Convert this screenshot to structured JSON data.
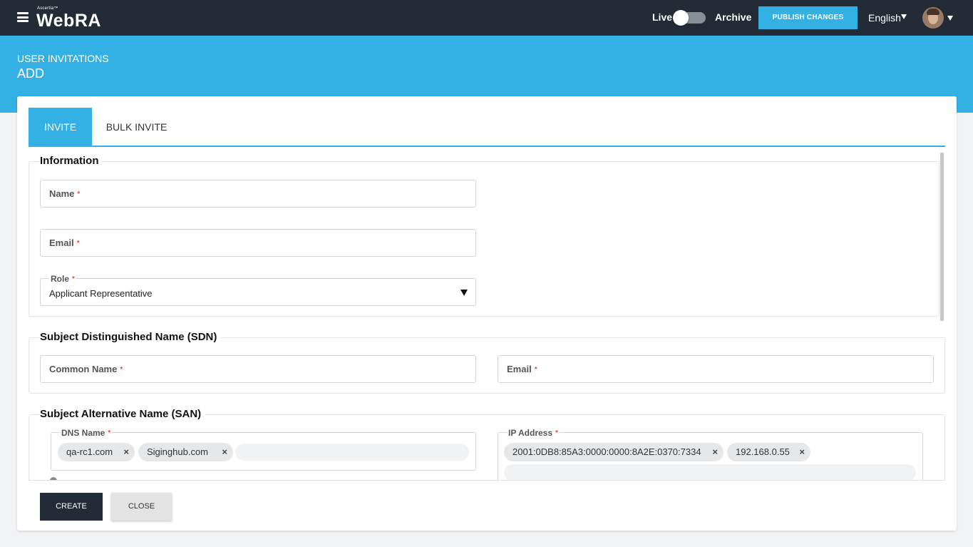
{
  "header": {
    "brand_small": "Ascertia™",
    "brand": "WebRA",
    "toggle_live": "Live",
    "toggle_archive": "Archive",
    "publish_label": "PUBLISH CHANGES",
    "language": "English"
  },
  "page": {
    "breadcrumb": "USER INVITATIONS",
    "title": "ADD"
  },
  "tabs": [
    {
      "label": "INVITE",
      "active": true
    },
    {
      "label": "BULK INVITE",
      "active": false
    }
  ],
  "information": {
    "title": "Information",
    "name_label": "Name",
    "email_label": "Email",
    "role_label": "Role",
    "role_value": "Applicant Representative",
    "required_mark": "*"
  },
  "sdn": {
    "title": "Subject Distinguished Name (SDN)",
    "common_name_label": "Common Name",
    "email_label": "Email"
  },
  "san": {
    "title": "Subject Alternative Name (SAN)",
    "dns_label": "DNS Name",
    "dns_chips": [
      "qa-rc1.com",
      "Siginghub.com"
    ],
    "ip_label": "IP Address",
    "ip_chips": [
      "2001:0DB8:85A3:0000:0000:8A2E:0370:7334",
      "192.168.0.55"
    ],
    "chip_remove": "×"
  },
  "footer": {
    "create_label": "CREATE",
    "close_label": "CLOSE"
  },
  "colors": {
    "accent": "#34b1e4",
    "topbar": "#222b36",
    "required": "#d9534f"
  }
}
